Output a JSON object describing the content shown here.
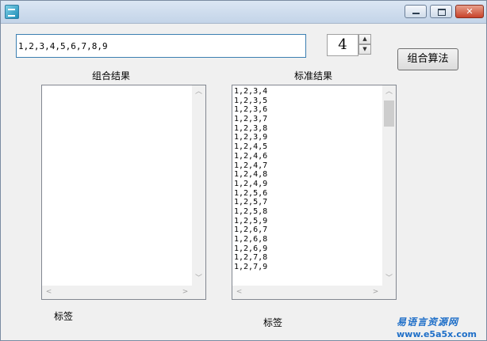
{
  "window": {
    "buttons": {
      "minimize_glyph": "▁",
      "maximize_glyph": "□",
      "close_glyph": "✕"
    }
  },
  "input": {
    "value": "1,2,3,4,5,6,7,8,9"
  },
  "spinner": {
    "value": "4",
    "up_glyph": "▲",
    "down_glyph": "▼"
  },
  "button": {
    "label": "组合算法"
  },
  "left_list": {
    "caption": "组合结果",
    "items": []
  },
  "right_list": {
    "caption": "标准结果",
    "items": [
      "1,2,3,4",
      "1,2,3,5",
      "1,2,3,6",
      "1,2,3,7",
      "1,2,3,8",
      "1,2,3,9",
      "1,2,4,5",
      "1,2,4,6",
      "1,2,4,7",
      "1,2,4,8",
      "1,2,4,9",
      "1,2,5,6",
      "1,2,5,7",
      "1,2,5,8",
      "1,2,5,9",
      "1,2,6,7",
      "1,2,6,8",
      "1,2,6,9",
      "1,2,7,8",
      "1,2,7,9"
    ]
  },
  "scroll_glyphs": {
    "up": "︿",
    "down": "﹀",
    "left": "<",
    "right": ">"
  },
  "labels": {
    "label_left": "标签",
    "label_right": "标签"
  },
  "watermark": {
    "text": "易语言资源网",
    "url": "www.e5a5x.com"
  }
}
